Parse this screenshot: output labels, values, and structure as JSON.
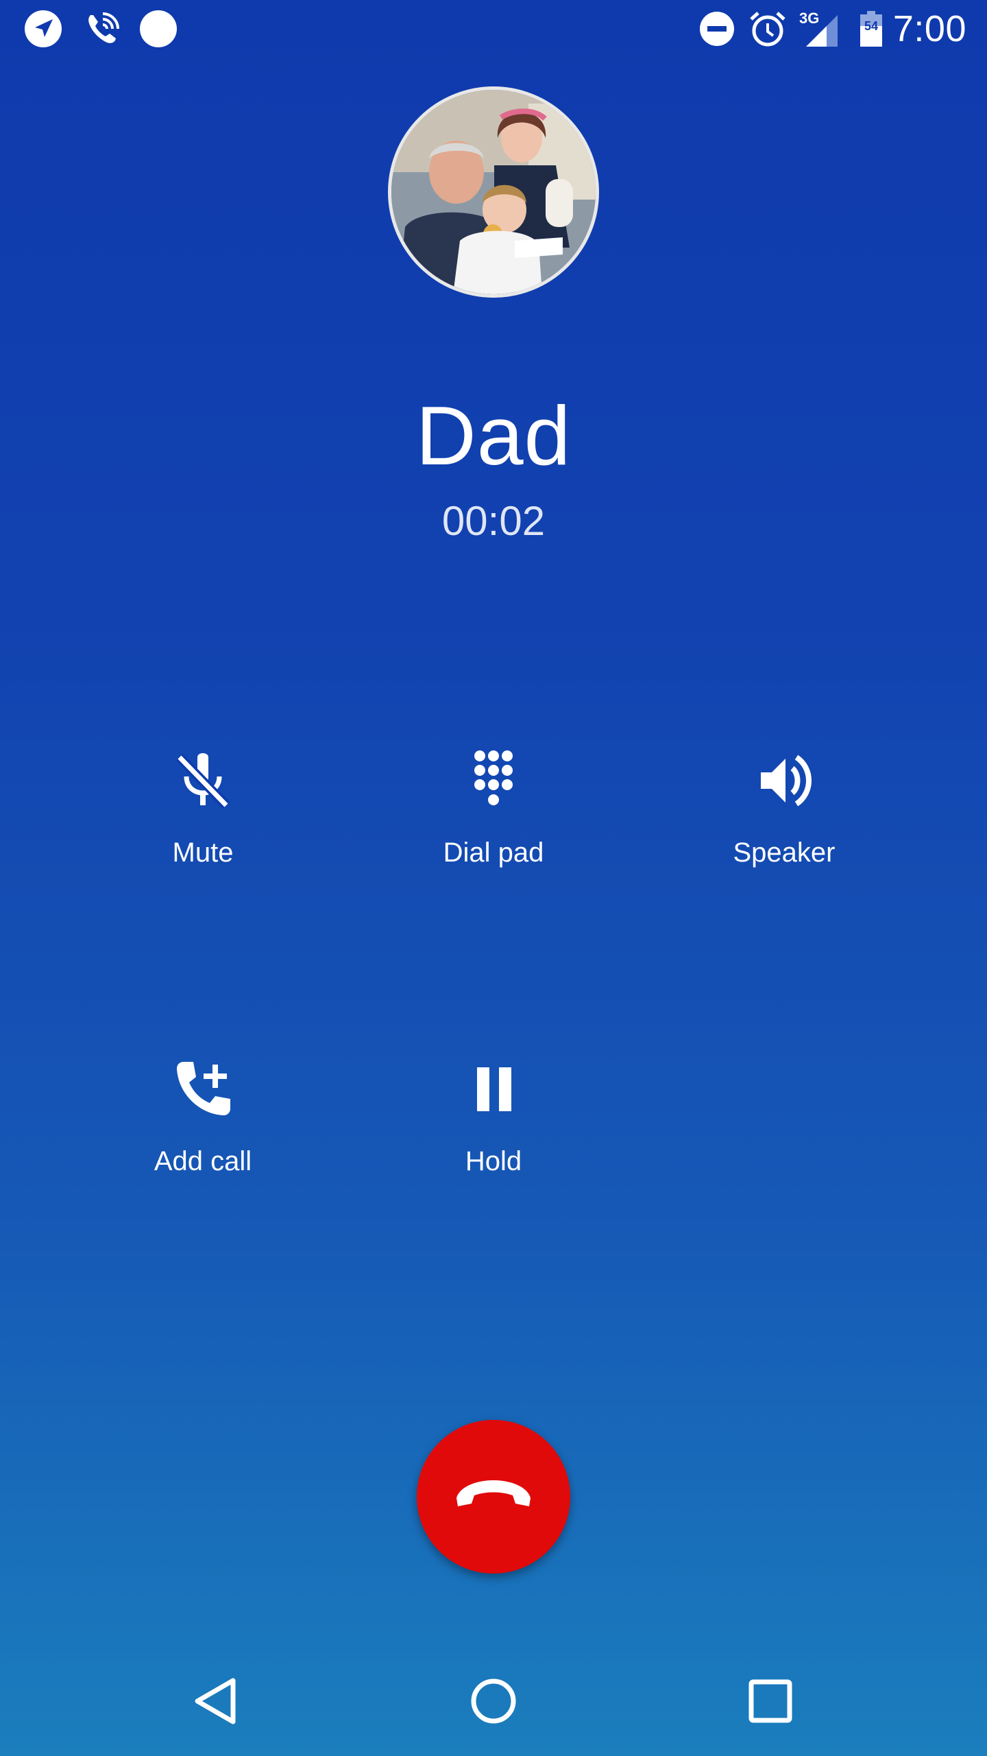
{
  "status_bar": {
    "time": "7:00",
    "network_type": "3G",
    "battery_level": "54",
    "icons": [
      "navigation-icon",
      "wifi-call-icon",
      "dot-icon",
      "do-not-disturb-icon",
      "alarm-icon",
      "signal-icon",
      "battery-icon"
    ]
  },
  "call": {
    "caller_name": "Dad",
    "duration": "00:02"
  },
  "controls": [
    {
      "label": "Mute",
      "icon": "mic-off-icon"
    },
    {
      "label": "Dial pad",
      "icon": "dialpad-icon"
    },
    {
      "label": "Speaker",
      "icon": "speaker-icon"
    },
    {
      "label": "Add call",
      "icon": "add-call-icon"
    },
    {
      "label": "Hold",
      "icon": "pause-icon"
    }
  ],
  "end_call": {
    "icon": "call-end-icon",
    "color": "#e10a0a"
  },
  "nav_bar": {
    "icons": [
      "back-icon",
      "home-icon",
      "recents-icon"
    ]
  },
  "colors": {
    "background_top": "#0f3aad",
    "background_bottom": "#1b7ebd",
    "text": "#ffffff"
  }
}
